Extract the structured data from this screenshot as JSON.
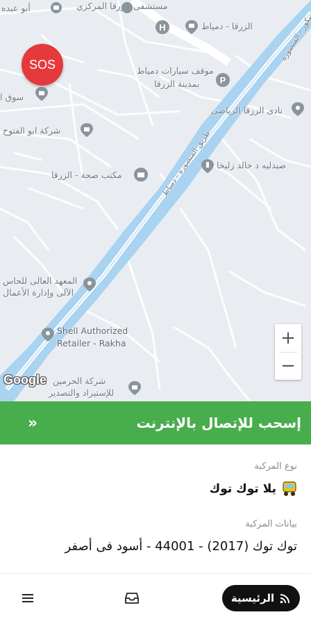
{
  "map": {
    "sos_label": "SOS",
    "google_logo": "Google",
    "zoom_in": "+",
    "zoom_out": "−",
    "labels": {
      "abu_obaida": "أبو عبده",
      "hospital": "مستشفى الزرقا المركزي",
      "zarqa_damietta_top": "الزرقا - دمياط",
      "mansoura_top": "فارسكور - المنصورة",
      "car_parking": "موقف سيارات دمياط",
      "car_parking_2": "بمدينة الزرقا",
      "souq": "سوق ا",
      "sports_club": "نادى الزرقا الرياضى",
      "abu_alfotouh": "شركة ابو الفتوح",
      "road_mansoura": "طريق المنصورة - دمياط",
      "pharmacy": "صيدليه د خالد زليخا",
      "health_office": "مكتب صحة - الزرقا",
      "institute_1": "المعهد العالى للحاس",
      "institute_2": "الآلى وإدارة الأعمال",
      "shell_1": "Shell Authorized",
      "shell_2": "Retailer - Rakha",
      "haramain_1": "شركة الحرمين",
      "haramain_2": "للإستيراد والتصدير"
    }
  },
  "swipe": {
    "label": "إسحب للإتصال بالإنترنت",
    "arrows": "»"
  },
  "details": {
    "vehicle_type_label": "نوع المركبة",
    "vehicle_type_value": "يلا توك توك",
    "vehicle_data_label": "بيانات المركبة",
    "vehicle_data_value": "توك توك (2017) - 44001 - أسود فى أصفر"
  },
  "nav": {
    "home_label": "الرئيسية",
    "icons": [
      "menu-icon",
      "inbox-icon",
      "signal-icon"
    ]
  },
  "colors": {
    "green": "#48ad4c",
    "sos_red": "#e5393b",
    "canal": "#a9d3f0",
    "dark": "#111111"
  }
}
